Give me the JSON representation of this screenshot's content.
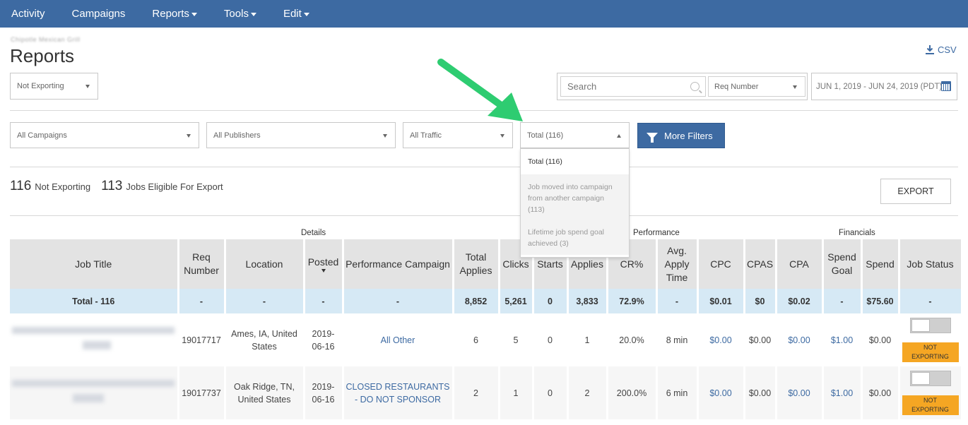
{
  "nav": {
    "items": [
      {
        "label": "Activity",
        "dropdown": false
      },
      {
        "label": "Campaigns",
        "dropdown": false
      },
      {
        "label": "Reports",
        "dropdown": true
      },
      {
        "label": "Tools",
        "dropdown": true
      },
      {
        "label": "Edit",
        "dropdown": true
      }
    ]
  },
  "header": {
    "subtitle": "Chipotle Mexican Grill",
    "title": "Reports",
    "csv_label": "CSV"
  },
  "filters": {
    "export_status": "Not Exporting",
    "search_placeholder": "Search",
    "req_number": "Req Number",
    "date_range": "JUN 1, 2019 - JUN 24, 2019 (PDT)",
    "campaigns": "All Campaigns",
    "publishers": "All Publishers",
    "traffic": "All Traffic",
    "total": "Total (116)",
    "more_filters": "More Filters"
  },
  "dropdown": {
    "options": [
      "Total (116)",
      "Job moved into campaign from another campaign (113)",
      "Lifetime job spend goal achieved (3)"
    ]
  },
  "summary": {
    "not_exporting_count": "116",
    "not_exporting_label": "Not Exporting",
    "eligible_count": "113",
    "eligible_label": "Jobs Eligible For Export",
    "export_button": "EXPORT"
  },
  "table": {
    "groups": {
      "details": "Details",
      "performance": "Performance",
      "financials": "Financials"
    },
    "headers": {
      "job_title": "Job Title",
      "req_number": "Req Number",
      "location": "Location",
      "posted": "Posted",
      "campaign": "Performance Campaign",
      "total_applies": "Total Applies",
      "clicks": "Clicks",
      "starts": "Starts",
      "applies": "Applies",
      "cr": "CR%",
      "apply_time": "Avg. Apply Time",
      "cpc": "CPC",
      "cpas": "CPAS",
      "cpa": "CPA",
      "spend_goal": "Spend Goal",
      "spend": "Spend",
      "job_status": "Job Status"
    },
    "total": {
      "label": "Total - 116",
      "req": "-",
      "location": "-",
      "posted": "-",
      "campaign": "-",
      "total_applies": "8,852",
      "clicks": "5,261",
      "starts": "0",
      "applies": "3,833",
      "cr": "72.9%",
      "apply_time": "-",
      "cpc": "$0.01",
      "cpas": "$0",
      "cpa": "$0.02",
      "spend_goal": "-",
      "spend": "$75.60",
      "status": "-"
    },
    "rows": [
      {
        "req": "19017717",
        "location": "Ames, IA, United States",
        "posted": "2019-06-16",
        "campaign": "All Other",
        "total_applies": "6",
        "clicks": "5",
        "starts": "0",
        "applies": "1",
        "cr": "20.0%",
        "apply_time": "8 min",
        "cpc": "$0.00",
        "cpas": "$0.00",
        "cpa": "$0.00",
        "spend_goal": "$1.00",
        "spend": "$0.00",
        "status": "NOT EXPORTING"
      },
      {
        "req": "19017737",
        "location": "Oak Ridge, TN, United States",
        "posted": "2019-06-16",
        "campaign": "CLOSED RESTAURANTS - DO NOT SPONSOR",
        "total_applies": "2",
        "clicks": "1",
        "starts": "0",
        "applies": "2",
        "cr": "200.0%",
        "apply_time": "6 min",
        "cpc": "$0.00",
        "cpas": "$0.00",
        "cpa": "$0.00",
        "spend_goal": "$1.00",
        "spend": "$0.00",
        "status": "NOT EXPORTING"
      }
    ]
  },
  "colors": {
    "nav_bg": "#3d6aa2",
    "accent": "#3d6aa2",
    "total_row": "#d6e9f5",
    "badge": "#f5a623",
    "arrow": "#2ecc71"
  }
}
